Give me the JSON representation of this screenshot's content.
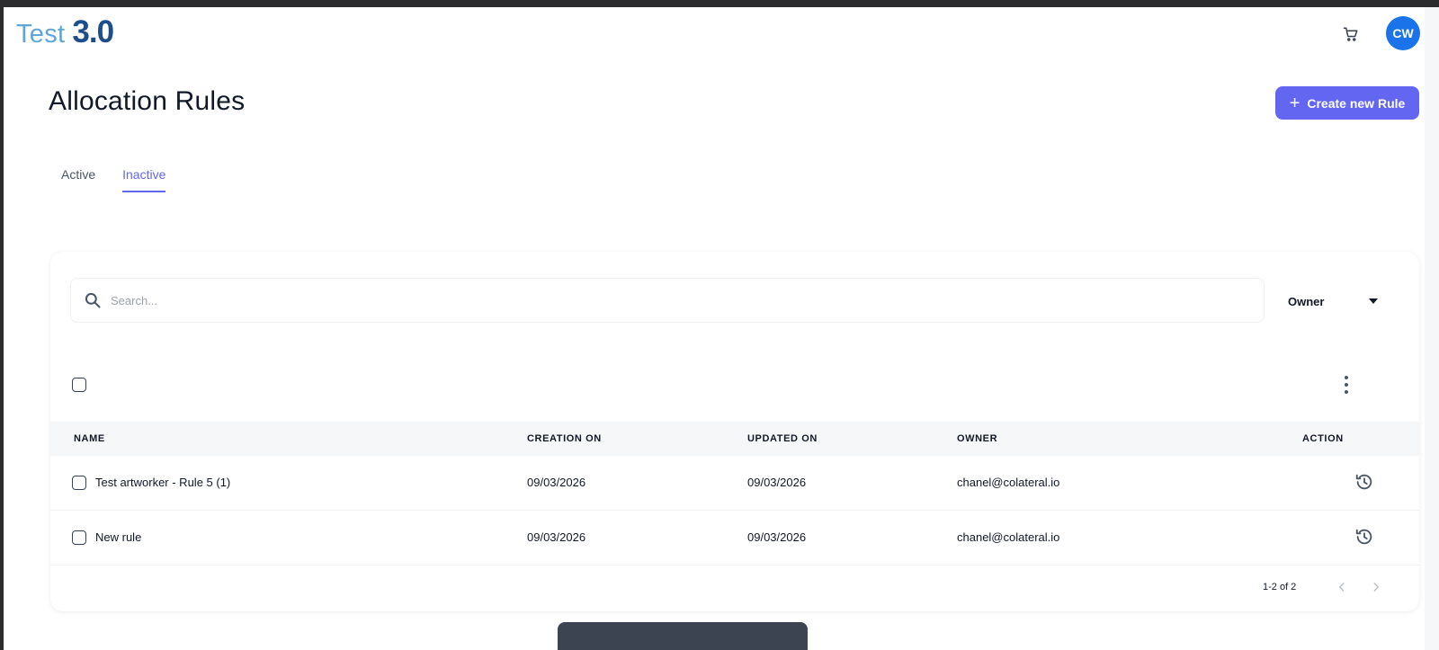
{
  "app": {
    "logo_word": "Test",
    "logo_version": "3.0",
    "avatar_initials": "CW",
    "accent_color": "#6366f1",
    "avatar_color": "#1a73e8"
  },
  "header": {
    "title": "Allocation Rules",
    "create_label": "Create new Rule"
  },
  "tabs": [
    {
      "label": "Active",
      "active": false
    },
    {
      "label": "Inactive",
      "active": true
    }
  ],
  "filters": {
    "search_placeholder": "Search...",
    "owner_label": "Owner"
  },
  "table": {
    "columns": [
      "NAME",
      "CREATION ON",
      "UPDATED ON",
      "OWNER",
      "ACTION"
    ],
    "rows": [
      {
        "name": "Test artworker - Rule 5 (1)",
        "created": "09/03/2026",
        "updated": "09/03/2026",
        "owner": "chanel@colateral.io",
        "action_icon": "history-icon"
      },
      {
        "name": "New rule",
        "created": "09/03/2026",
        "updated": "09/03/2026",
        "owner": "chanel@colateral.io",
        "action_icon": "history-icon"
      }
    ],
    "pagination": "1-2 of 2"
  }
}
